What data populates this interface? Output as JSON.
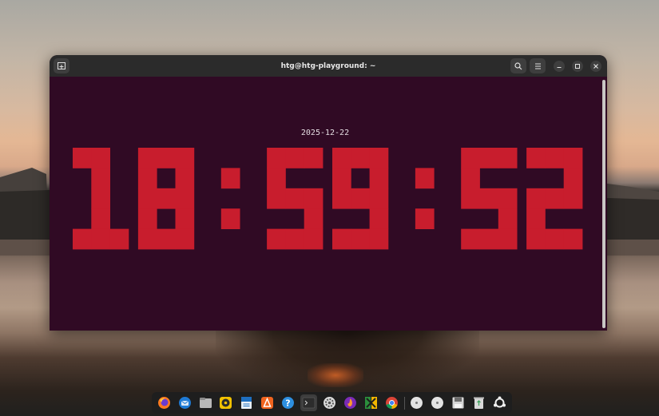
{
  "window": {
    "title": "htg@htg-playground: ~"
  },
  "terminal": {
    "date": "2025-12-22",
    "time": "18:59:52",
    "digit_color": "#c81d2d",
    "background_color": "#300a24"
  },
  "dock": {
    "items": [
      "firefox-icon",
      "thunderbird-icon",
      "files-icon",
      "rhythmbox-icon",
      "writer-icon",
      "app-center-icon",
      "help-icon",
      "terminal-icon",
      "settings-icon",
      "flame-app-icon",
      "app-x-icon",
      "chrome-icon",
      "disc-icon",
      "disc-icon",
      "save-icon",
      "trash-icon",
      "show-apps-icon"
    ]
  }
}
